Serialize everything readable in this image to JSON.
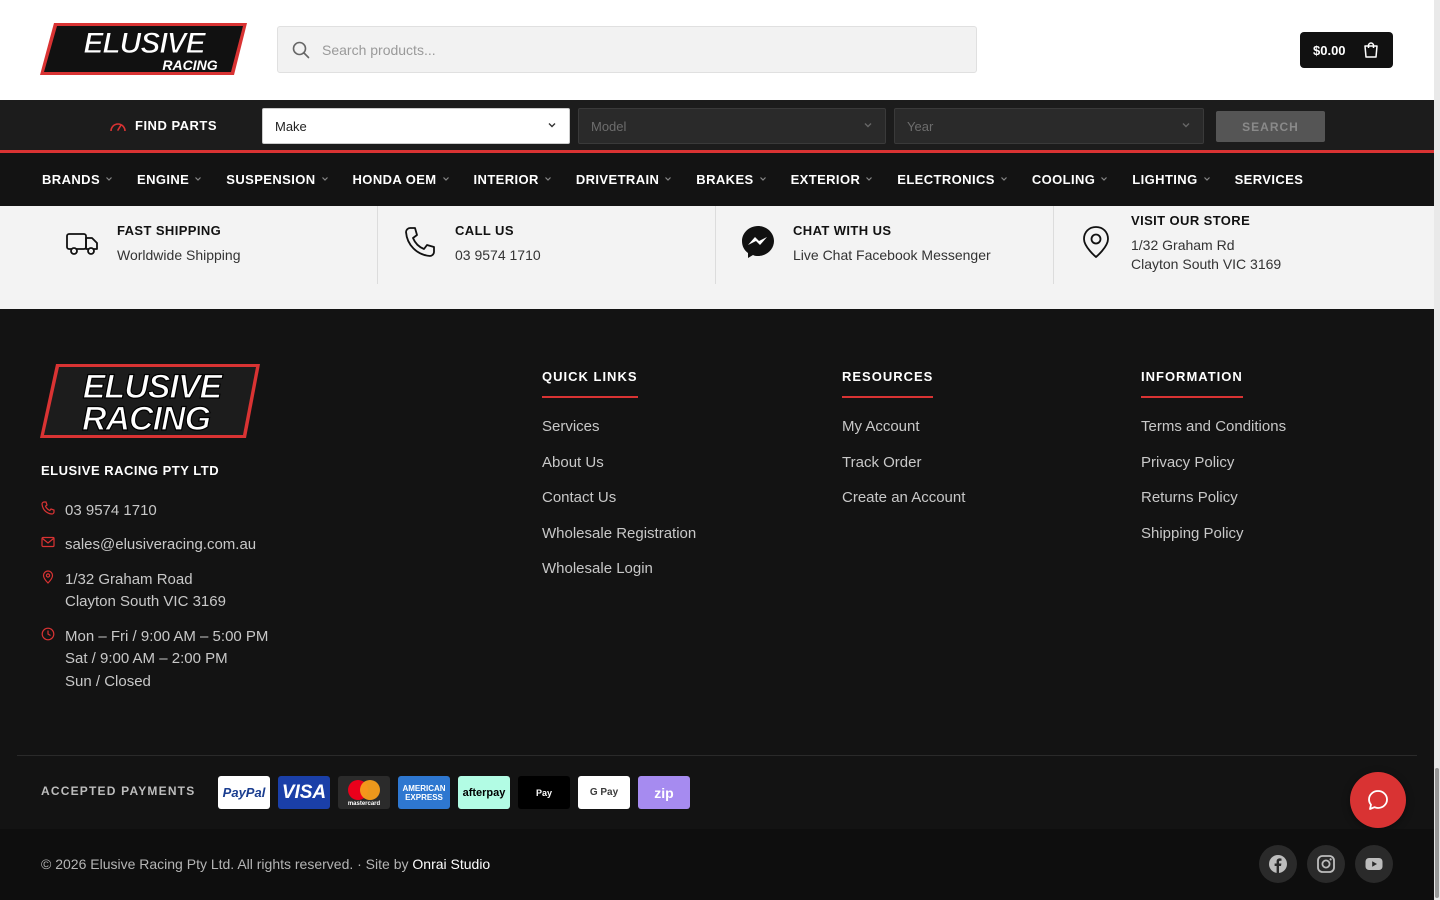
{
  "header": {
    "logo_text": "ELUSIVE RACING",
    "search_placeholder": "Search products...",
    "cart_total": "$0.00"
  },
  "find_parts": {
    "label": "FIND PARTS",
    "make": "Make",
    "model": "Model",
    "year": "Year",
    "search_button": "SEARCH"
  },
  "categories": [
    {
      "label": "BRANDS",
      "dropdown": true
    },
    {
      "label": "ENGINE",
      "dropdown": true
    },
    {
      "label": "SUSPENSION",
      "dropdown": true
    },
    {
      "label": "HONDA OEM",
      "dropdown": true
    },
    {
      "label": "INTERIOR",
      "dropdown": true
    },
    {
      "label": "DRIVETRAIN",
      "dropdown": true
    },
    {
      "label": "BRAKES",
      "dropdown": true
    },
    {
      "label": "EXTERIOR",
      "dropdown": true
    },
    {
      "label": "ELECTRONICS",
      "dropdown": true
    },
    {
      "label": "COOLING",
      "dropdown": true
    },
    {
      "label": "LIGHTING",
      "dropdown": true
    },
    {
      "label": "SERVICES",
      "dropdown": false
    }
  ],
  "features": [
    {
      "icon": "truck-icon",
      "title": "FAST SHIPPING",
      "lines": [
        "Worldwide Shipping"
      ]
    },
    {
      "icon": "phone-icon",
      "title": "CALL US",
      "lines": [
        "03 9574 1710"
      ]
    },
    {
      "icon": "messenger-icon",
      "title": "CHAT WITH US",
      "lines": [
        "Live Chat Facebook Messenger"
      ]
    },
    {
      "icon": "location-icon",
      "title": "VISIT OUR STORE",
      "lines": [
        "1/32 Graham Rd",
        "Clayton South VIC 3169"
      ]
    }
  ],
  "footer": {
    "company": "ELUSIVE RACING PTY LTD",
    "phone": "03 9574 1710",
    "email": "sales@elusiveracing.com.au",
    "address_line1": "1/32 Graham Road",
    "address_line2": "Clayton South VIC 3169",
    "hours_line1": "Mon – Fri / 9:00 AM – 5:00 PM",
    "hours_line2": "Sat / 9:00 AM – 2:00 PM",
    "hours_line3": "Sun / Closed",
    "quick_links": {
      "title": "QUICK LINKS",
      "items": [
        "Services",
        "About Us",
        "Contact Us",
        "Wholesale Registration",
        "Wholesale Login"
      ]
    },
    "resources": {
      "title": "RESOURCES",
      "items": [
        "My Account",
        "Track Order",
        "Create an Account"
      ]
    },
    "information": {
      "title": "INFORMATION",
      "items": [
        "Terms and Conditions",
        "Privacy Policy",
        "Returns Policy",
        "Shipping Policy"
      ]
    }
  },
  "payments": {
    "label": "ACCEPTED PAYMENTS",
    "methods": [
      {
        "name": "PayPal",
        "bg": "#ffffff",
        "color": "#1a3d8f"
      },
      {
        "name": "VISA",
        "bg": "#1a3fa8",
        "color": "#ffffff"
      },
      {
        "name": "mastercard",
        "bg": "#2b2b2b",
        "color": "#ffffff"
      },
      {
        "name": "AMERICAN EXPRESS",
        "bg": "#2e77d0",
        "color": "#ffffff"
      },
      {
        "name": "afterpay",
        "bg": "#b2fce4",
        "color": "#000000"
      },
      {
        "name": "Pay",
        "bg": "#000000",
        "color": "#ffffff"
      },
      {
        "name": "G Pay",
        "bg": "#ffffff",
        "color": "#3c3c3c"
      },
      {
        "name": "zip",
        "bg": "#a68bf0",
        "color": "#ffffff"
      }
    ]
  },
  "bottom": {
    "copyright": "© 2026 Elusive Racing Pty Ltd. All rights reserved. · Site by ",
    "studio": "Onrai Studio",
    "social": [
      "facebook-icon",
      "instagram-icon",
      "youtube-icon"
    ]
  },
  "colors": {
    "accent": "#d93333",
    "dark": "#131313"
  }
}
